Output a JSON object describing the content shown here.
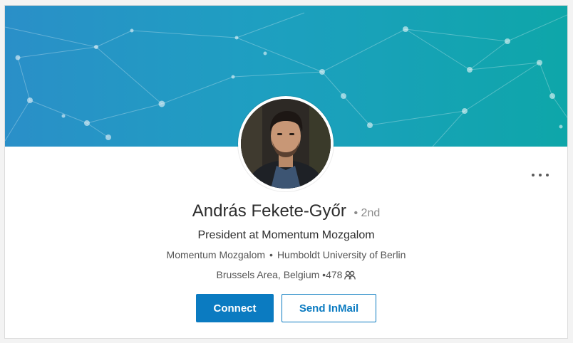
{
  "profile": {
    "name": "András Fekete-Győr",
    "degree": "• 2nd",
    "headline": "President at Momentum Mozgalom",
    "current_org": "Momentum Mozgalom",
    "education": "Humboldt University of Berlin",
    "location": "Brussels Area, Belgium",
    "connections": "•478"
  },
  "actions": {
    "connect_label": "Connect",
    "inmail_label": "Send InMail"
  },
  "icons": {
    "more": "more-options-icon",
    "connections": "people-icon"
  },
  "colors": {
    "primary": "#0b7bc1",
    "banner_start": "#2a8fc8",
    "banner_end": "#0ea6a9"
  }
}
